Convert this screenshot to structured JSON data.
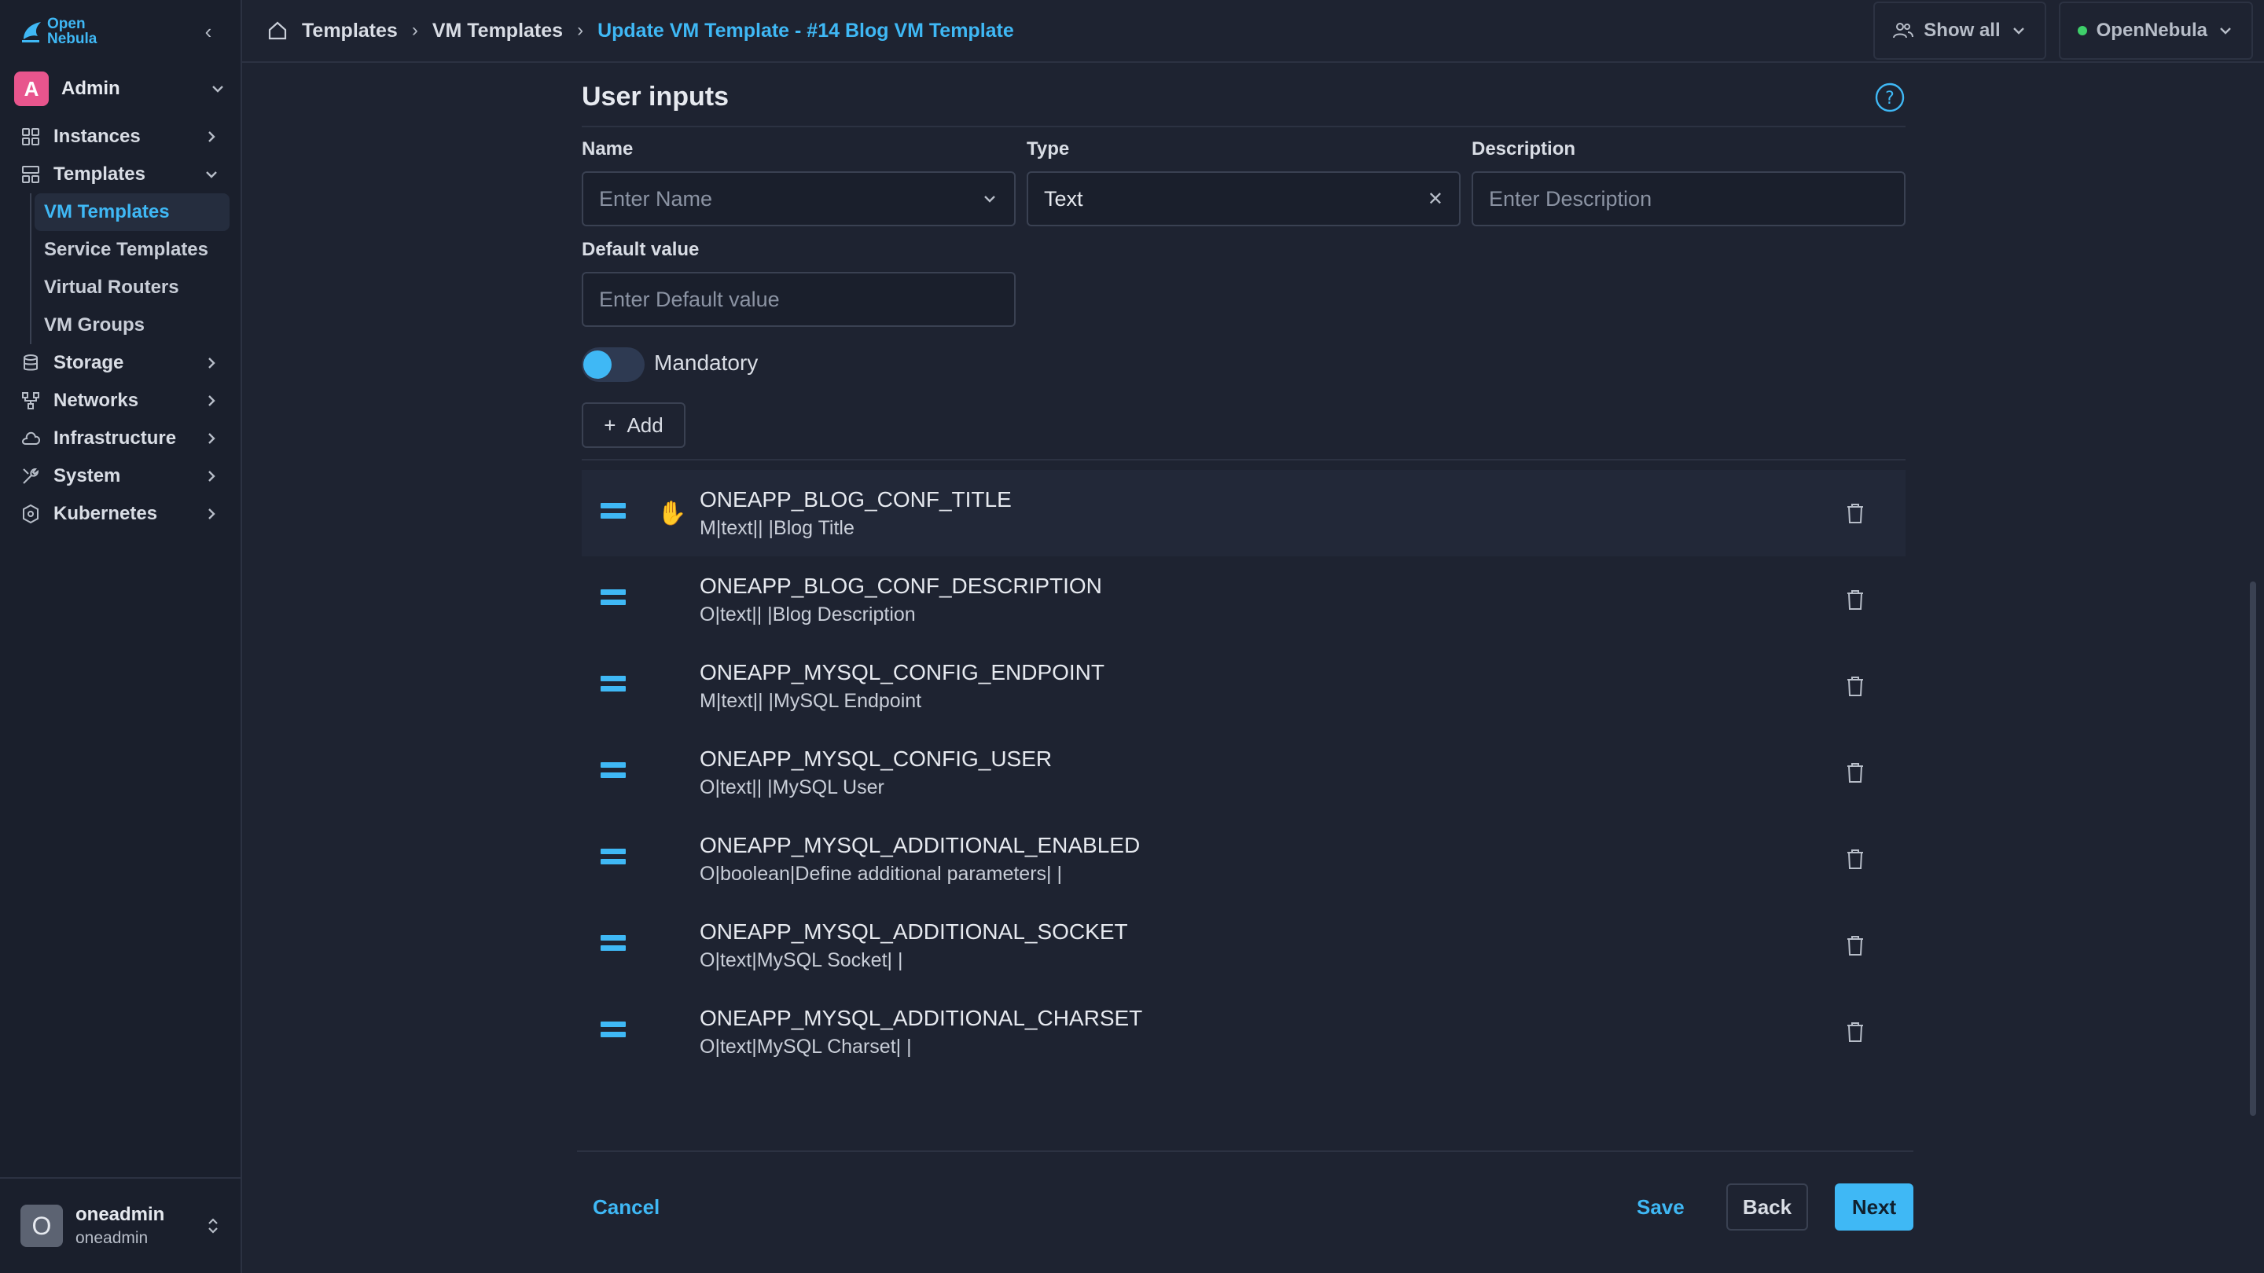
{
  "app": {
    "logo_text_1": "Open",
    "logo_text_2": "Nebula"
  },
  "sidebar": {
    "group": {
      "initial": "A",
      "name": "Admin"
    },
    "items": [
      {
        "label": "Instances",
        "icon": "instances-icon"
      },
      {
        "label": "Templates",
        "icon": "templates-icon"
      }
    ],
    "templates_sub": [
      "VM Templates",
      "Service Templates",
      "Virtual Routers",
      "VM Groups"
    ],
    "items_after": [
      {
        "label": "Storage",
        "icon": "storage-icon"
      },
      {
        "label": "Networks",
        "icon": "networks-icon"
      },
      {
        "label": "Infrastructure",
        "icon": "cloud-icon"
      },
      {
        "label": "System",
        "icon": "system-icon"
      },
      {
        "label": "Kubernetes",
        "icon": "kubernetes-icon"
      }
    ],
    "footer": {
      "initial": "O",
      "name": "oneadmin",
      "sub": "oneadmin"
    }
  },
  "breadcrumb": {
    "items": [
      "Templates",
      "VM Templates"
    ],
    "current": "Update VM Template - #14 Blog VM Template"
  },
  "topbar": {
    "show_all": "Show all",
    "zone": "OpenNebula"
  },
  "form": {
    "title": "User inputs",
    "name_label": "Name",
    "name_placeholder": "Enter Name",
    "type_label": "Type",
    "type_value": "Text",
    "description_label": "Description",
    "description_placeholder": "Enter Description",
    "default_label": "Default value",
    "default_placeholder": "Enter Default value",
    "mandatory_label": "Mandatory",
    "add_label": "Add"
  },
  "inputs": [
    {
      "name": "ONEAPP_BLOG_CONF_TITLE",
      "desc": "M|text|| |Blog Title"
    },
    {
      "name": "ONEAPP_BLOG_CONF_DESCRIPTION",
      "desc": "O|text|| |Blog Description"
    },
    {
      "name": "ONEAPP_MYSQL_CONFIG_ENDPOINT",
      "desc": "M|text|| |MySQL Endpoint"
    },
    {
      "name": "ONEAPP_MYSQL_CONFIG_USER",
      "desc": "O|text|| |MySQL User"
    },
    {
      "name": "ONEAPP_MYSQL_ADDITIONAL_ENABLED",
      "desc": "O|boolean|Define additional parameters| |"
    },
    {
      "name": "ONEAPP_MYSQL_ADDITIONAL_SOCKET",
      "desc": "O|text|MySQL Socket| |"
    },
    {
      "name": "ONEAPP_MYSQL_ADDITIONAL_CHARSET",
      "desc": "O|text|MySQL Charset| |"
    }
  ],
  "actions": {
    "cancel": "Cancel",
    "save": "Save",
    "back": "Back",
    "next": "Next"
  },
  "colors": {
    "accent": "#3fb8f5",
    "background": "#1e2331",
    "sidebar": "#1a1f2c"
  }
}
